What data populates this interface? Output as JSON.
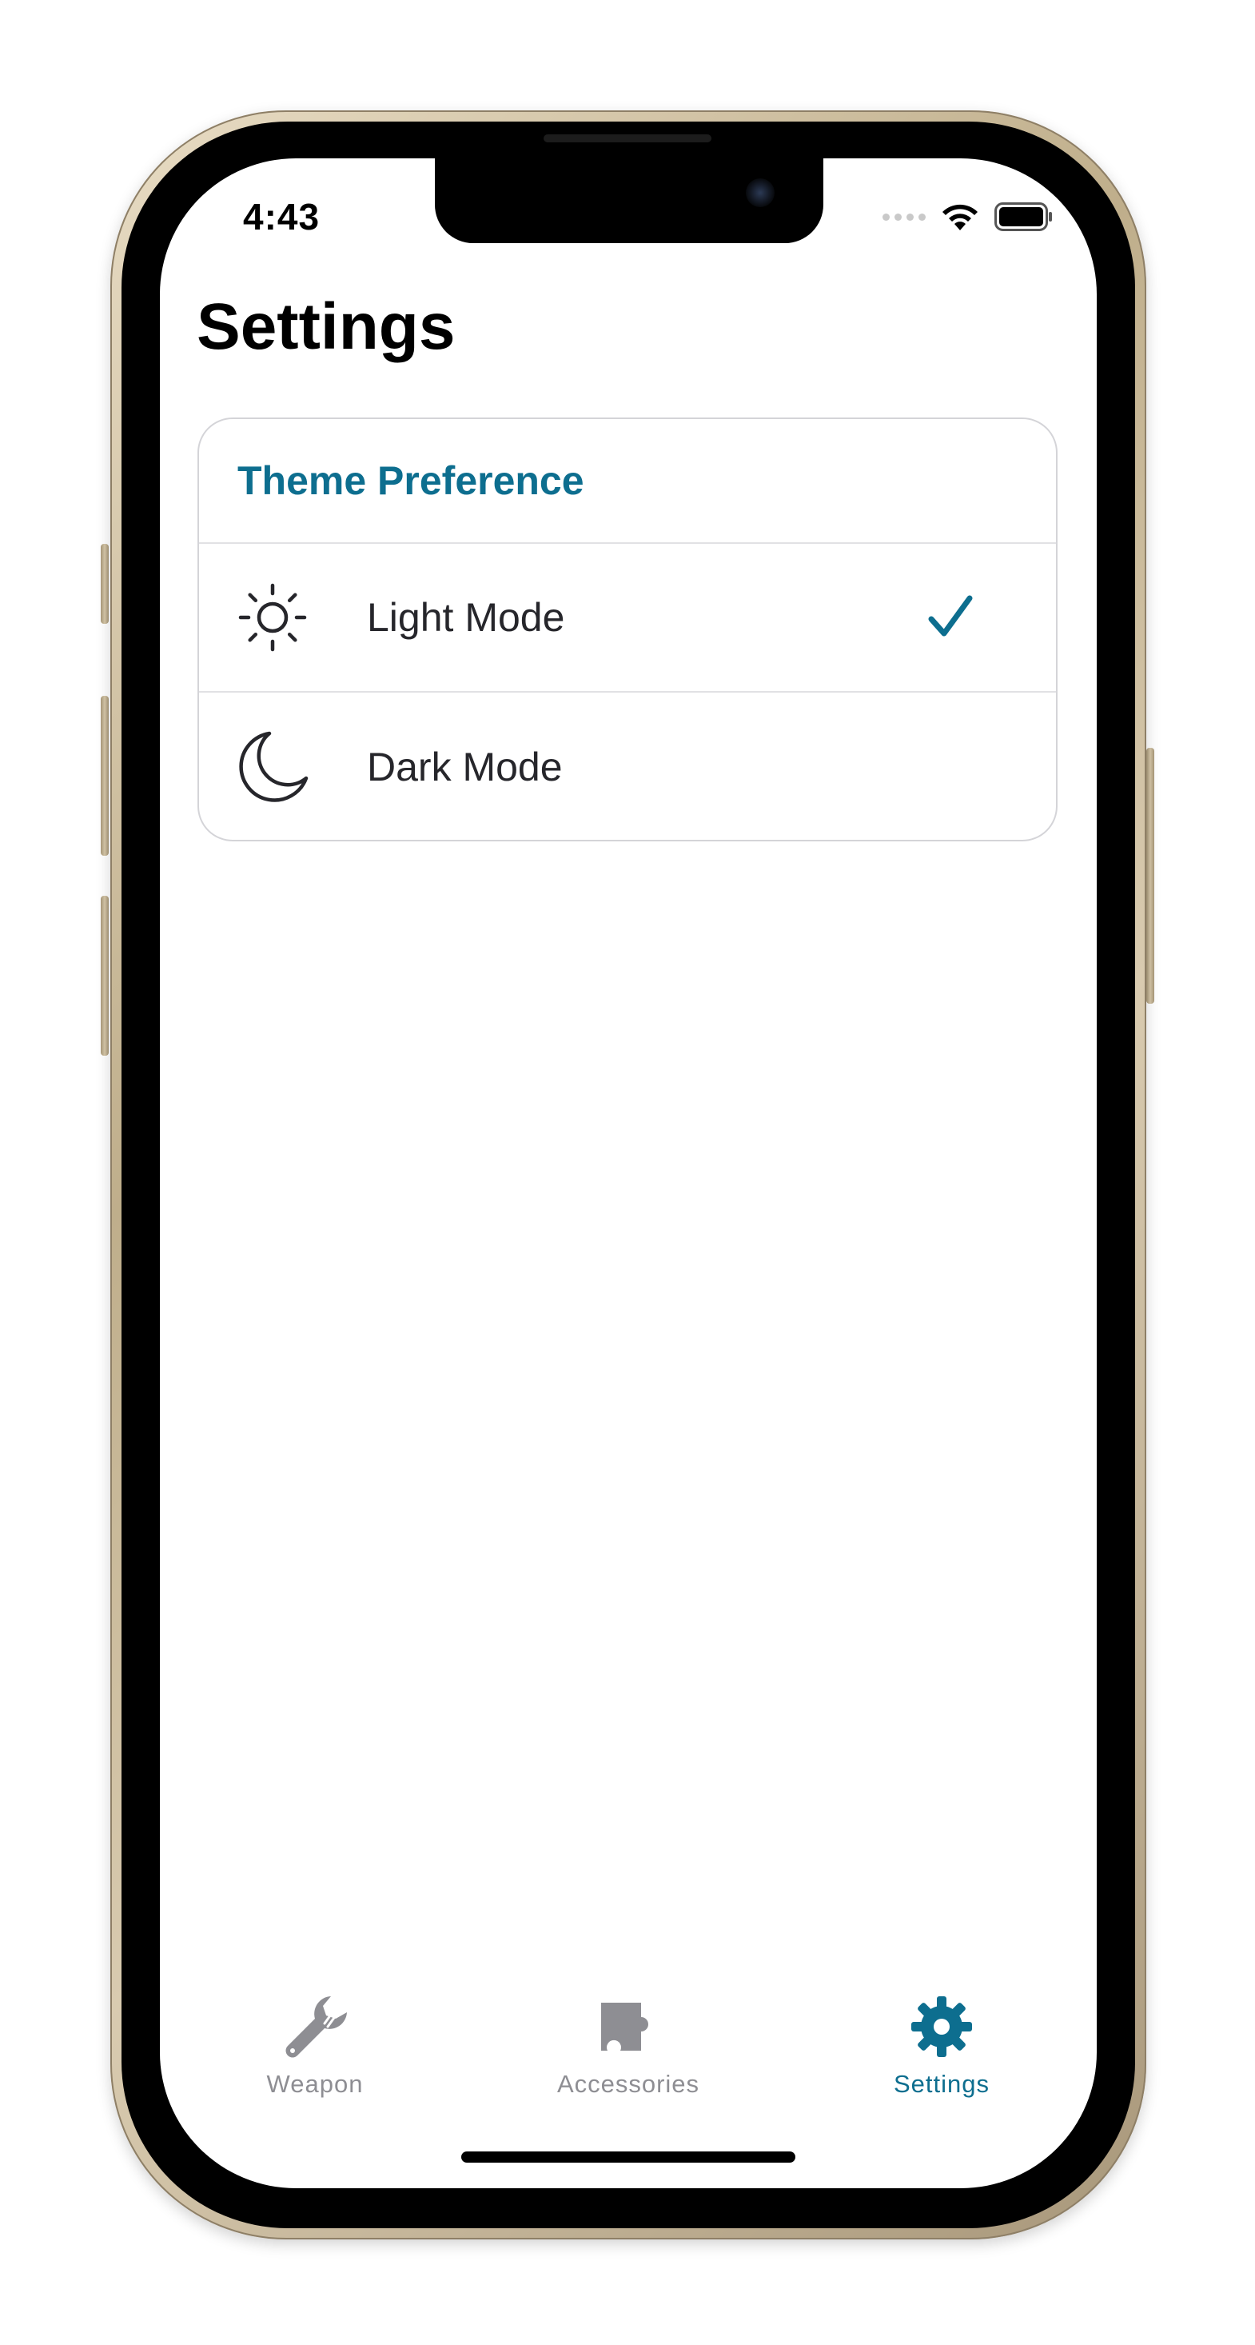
{
  "status_bar": {
    "time": "4:43"
  },
  "page": {
    "title": "Settings"
  },
  "theme_card": {
    "header": "Theme Preference",
    "options": [
      {
        "label": "Light Mode",
        "icon": "sun-icon",
        "selected": true
      },
      {
        "label": "Dark Mode",
        "icon": "moon-icon",
        "selected": false
      }
    ]
  },
  "tab_bar": {
    "tabs": [
      {
        "label": "Weapon",
        "icon": "wrench-icon",
        "active": false
      },
      {
        "label": "Accessories",
        "icon": "puzzle-icon",
        "active": false
      },
      {
        "label": "Settings",
        "icon": "gear-icon",
        "active": true
      }
    ]
  },
  "colors": {
    "accent": "#0d6e8f",
    "inactive_tab": "#8e8e93",
    "text_primary": "#26262b",
    "frame_gold": "#c8b895"
  }
}
